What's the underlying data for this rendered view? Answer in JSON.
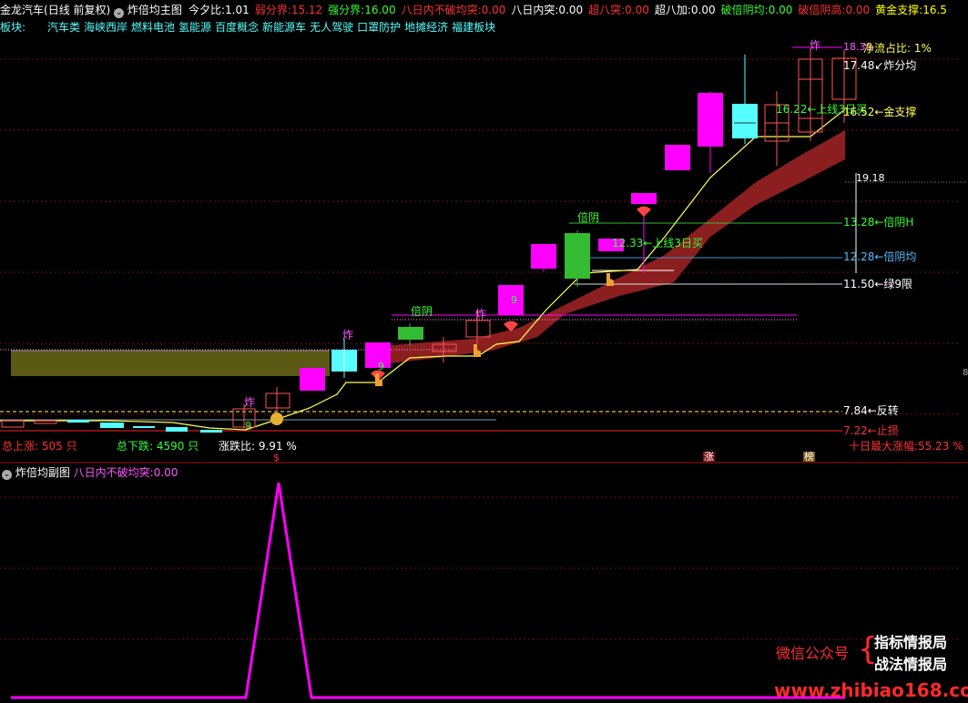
{
  "header": {
    "stock_name": "金龙汽车",
    "period": "(日线 前复权)",
    "indicator_name": "炸倍均主图",
    "items": [
      {
        "label": "今夕比:",
        "value": "1.01",
        "color": "#ffffff"
      },
      {
        "label": "弱分界:",
        "value": "15.12",
        "color": "#ff3030"
      },
      {
        "label": "强分界:",
        "value": "16.00",
        "color": "#33ff33"
      },
      {
        "label": "八日内不破均突:",
        "value": "0.00",
        "color": "#ff3030"
      },
      {
        "label": "八日内突:",
        "value": "0.00",
        "color": "#ffffff"
      },
      {
        "label": "超八突:",
        "value": "0.00",
        "color": "#ff3030"
      },
      {
        "label": "超八加:",
        "value": "0.00",
        "color": "#ffffff"
      },
      {
        "label": "破倍阴均:",
        "value": "0.00",
        "color": "#33ff33"
      },
      {
        "label": "破倍阴高:",
        "value": "0.00",
        "color": "#ff3030"
      },
      {
        "label": "黄金支撑:",
        "value": "16.5",
        "color": "#ffff00"
      }
    ]
  },
  "sectors": {
    "label": "板块:",
    "items": [
      "汽车类",
      "海峡西岸",
      "燃料电池",
      "氢能源",
      "百度概念",
      "新能源车",
      "无人驾驶",
      "口罩防护",
      "地摊经济",
      "福建板块"
    ]
  },
  "chart_labels": {
    "zha": "炸",
    "beiyin": "倍阴",
    "nine": "9",
    "price_1918": "19.18",
    "price_1838": "18.38",
    "jingliu": "净流占比: 1%",
    "zha_fenjun": "17.48↙炸分均",
    "upline1": "16.22←上线3日买",
    "jinzhicheng": "16.52←金支撑",
    "upline2": "12.33←上线3日买",
    "beiyinH": "13.28←倍阴H",
    "beiyinjun": "12.28←倍阴均",
    "lv9": "11.50←绿9限",
    "fanzhuan": "7.84←反转",
    "zhisun": "7.22←止损",
    "total_up": "总上涨: 505 只",
    "total_down": "总下跌: 4590 只",
    "zhangdiebi": "涨跌比: 9.91 %",
    "max_rise": "十日最大涨幅:55.23 %",
    "mark_zhang": "涨",
    "mark_bang": "榜",
    "mark_s": "$",
    "right_marker": "8"
  },
  "colors": {
    "up": "#ff00ff",
    "down_cyan": "#55ffff",
    "down_green": "#33bb33",
    "yellow_line": "#ffff55",
    "band": "#8b1f1f",
    "olive": "#5a5a14",
    "grid": "#7a1010"
  },
  "sub_panel": {
    "title": "炸倍均副图",
    "item_label": "八日内不破均突:",
    "item_value": "0.00",
    "line_color": "#ff00ff"
  },
  "watermark": {
    "wechat": "微信公众号",
    "brace": "{",
    "line1": "指标情报局",
    "line2": "战法情报局",
    "url": "www.zhibiao168.com"
  }
}
